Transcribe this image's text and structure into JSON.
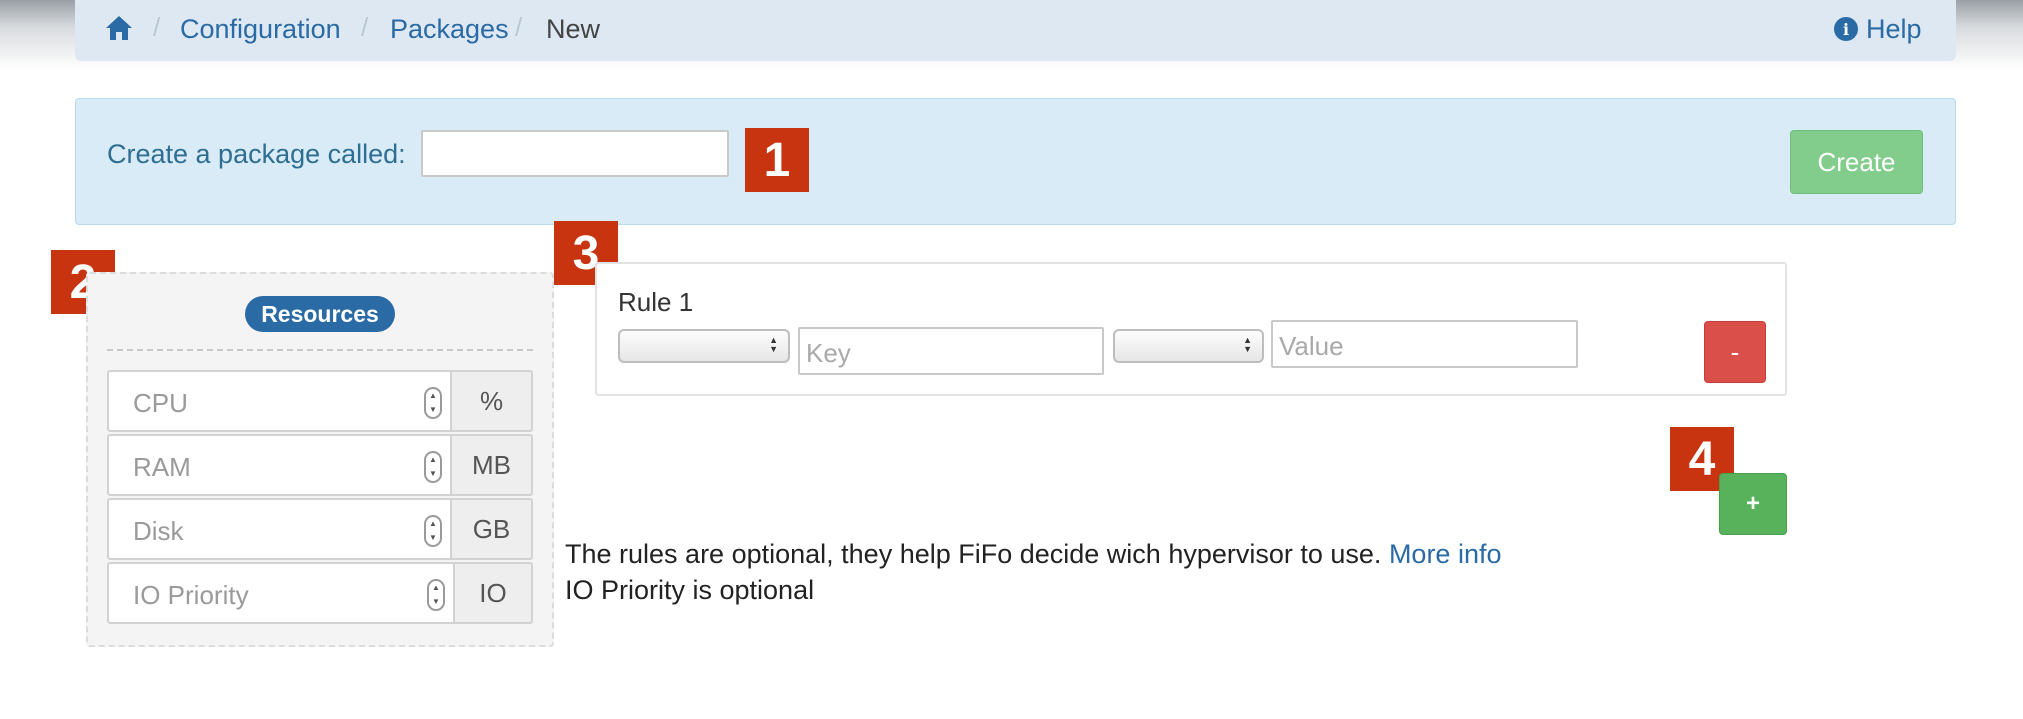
{
  "breadcrumb": {
    "home_icon": "home-icon",
    "items": [
      "Configuration",
      "Packages",
      "New"
    ],
    "separator": "/",
    "help_label": "Help",
    "help_icon": "info-circle-icon"
  },
  "create": {
    "label": "Create a package called:",
    "name_value": "",
    "button_label": "Create"
  },
  "callouts": [
    "1",
    "2",
    "3",
    "4"
  ],
  "resources": {
    "title": "Resources",
    "fields": [
      {
        "placeholder": "CPU",
        "unit": "%"
      },
      {
        "placeholder": "RAM",
        "unit": "MB"
      },
      {
        "placeholder": "Disk",
        "unit": "GB"
      },
      {
        "placeholder": "IO Priority",
        "unit": "IO"
      }
    ]
  },
  "rules": [
    {
      "title": "Rule 1",
      "key_placeholder": "Key",
      "value_placeholder": "Value",
      "remove_label": "-"
    }
  ],
  "add_rule_label": "+",
  "notes": {
    "rules_text": "The rules are optional, they help FiFo decide wich hypervisor to use.",
    "more_info": "More info",
    "io_note": "IO Priority is optional"
  },
  "colors": {
    "link": "#2a6aa5",
    "callout": "#c7340f",
    "create_button": "#82cd8b",
    "remove_button": "#da4f49",
    "add_button": "#58b15b"
  }
}
